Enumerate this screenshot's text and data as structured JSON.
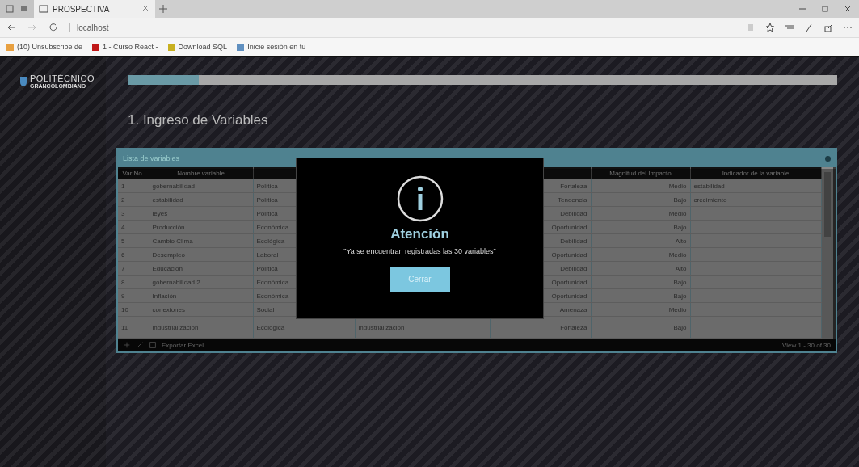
{
  "browser": {
    "tab_title": "PROSPECTIVA",
    "address": "localhost",
    "bookmarks": [
      {
        "label": "(10) Unsubscribe de",
        "color": "#e8a040"
      },
      {
        "label": "1 - Curso React -",
        "color": "#c01818"
      },
      {
        "label": "Download SQL",
        "color": "#c8b020"
      },
      {
        "label": "Inicie sesión en tu",
        "color": "#6090c0"
      }
    ]
  },
  "sidebar": {
    "logo_line_1": "POLITÉCNICO",
    "logo_line_2": "GRANCOLOMBIANO"
  },
  "progress": {
    "level": 0.1
  },
  "heading": "1. Ingreso de Variables",
  "grid": {
    "title": "Lista de variables",
    "headers": {
      "var_no": "Var No.",
      "nombre": "Nombre variable",
      "magnitud": "Magnitud del Impacto",
      "indicador": "Indicador de la variable"
    },
    "rows": [
      {
        "var_no": "1",
        "nombre": "gobernabilidad",
        "column_3": "Política",
        "column_5": "Fortaleza",
        "magnitud": "Medio",
        "indicador": "estabilidad"
      },
      {
        "var_no": "2",
        "nombre": "estabilidad",
        "column_3": "Política",
        "column_5": "Tendencia",
        "magnitud": "Bajo",
        "indicador": "crecimiento"
      },
      {
        "var_no": "3",
        "nombre": "leyes",
        "column_3": "Política",
        "column_5": "Debilidad",
        "magnitud": "Medio"
      },
      {
        "var_no": "4",
        "nombre": "Producción",
        "column_3": "Económica",
        "column_5": "Oportunidad",
        "magnitud": "Bajo"
      },
      {
        "var_no": "5",
        "nombre": "Cambio Clima",
        "column_3": "Ecológica",
        "column_5": "Debilidad",
        "magnitud": "Alto"
      },
      {
        "var_no": "6",
        "nombre": "Desempleo",
        "column_3": "Laboral",
        "column_5": "Oportunidad",
        "magnitud": "Medio"
      },
      {
        "var_no": "7",
        "nombre": "Educación",
        "column_3": "Política",
        "column_5": "Debilidad",
        "magnitud": "Alto"
      },
      {
        "var_no": "8",
        "nombre": "gobernabilidad 2",
        "column_3": "Económica",
        "column_5": "Oportunidad",
        "magnitud": "Bajo"
      },
      {
        "var_no": "9",
        "nombre": "Inflación",
        "column_3": "Económica",
        "column_5": "Oportunidad",
        "magnitud": "Bajo"
      },
      {
        "var_no": "10",
        "nombre": "conexiones",
        "column_3": "Social",
        "column_5": "Amenaza",
        "magnitud": "Medio"
      },
      {
        "var_no": "11",
        "nombre": "industrialización",
        "column_3": "Ecológica",
        "column_4": "industrialización",
        "column_5": "Fortaleza",
        "magnitud": "Bajo"
      }
    ],
    "footer_left": "Exportar Excel",
    "footer_right": "View 1 - 30 of 30"
  },
  "modal": {
    "title": "Atención",
    "message": "\"Ya se encuentran registradas las 30 variables\"",
    "button": "Cerrar"
  }
}
